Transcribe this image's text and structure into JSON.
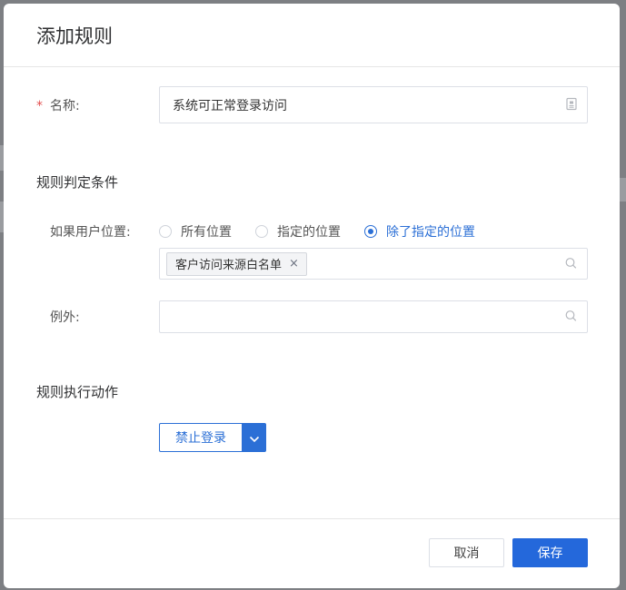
{
  "dialog": {
    "title": "添加规则"
  },
  "form": {
    "name": {
      "required_mark": "*",
      "label": "名称:",
      "value": "系统可正常登录访问",
      "icon": "id-card-icon"
    },
    "condition_section": {
      "title": "规则判定条件",
      "location_label": "如果用户位置:",
      "options": [
        {
          "label": "所有位置",
          "checked": false
        },
        {
          "label": "指定的位置",
          "checked": false
        },
        {
          "label": "除了指定的位置",
          "checked": true
        }
      ],
      "selected_tags": [
        {
          "label": "客户访问来源白名单",
          "close": "×"
        }
      ],
      "exception_label": "例外:",
      "exception_value": ""
    },
    "action_section": {
      "title": "规则执行动作",
      "action_value": "禁止登录"
    }
  },
  "footer": {
    "cancel_label": "取消",
    "save_label": "保存"
  },
  "colors": {
    "primary": "#2b6fd6",
    "required": "#e34d4d",
    "backdrop": "#7d7f83"
  }
}
